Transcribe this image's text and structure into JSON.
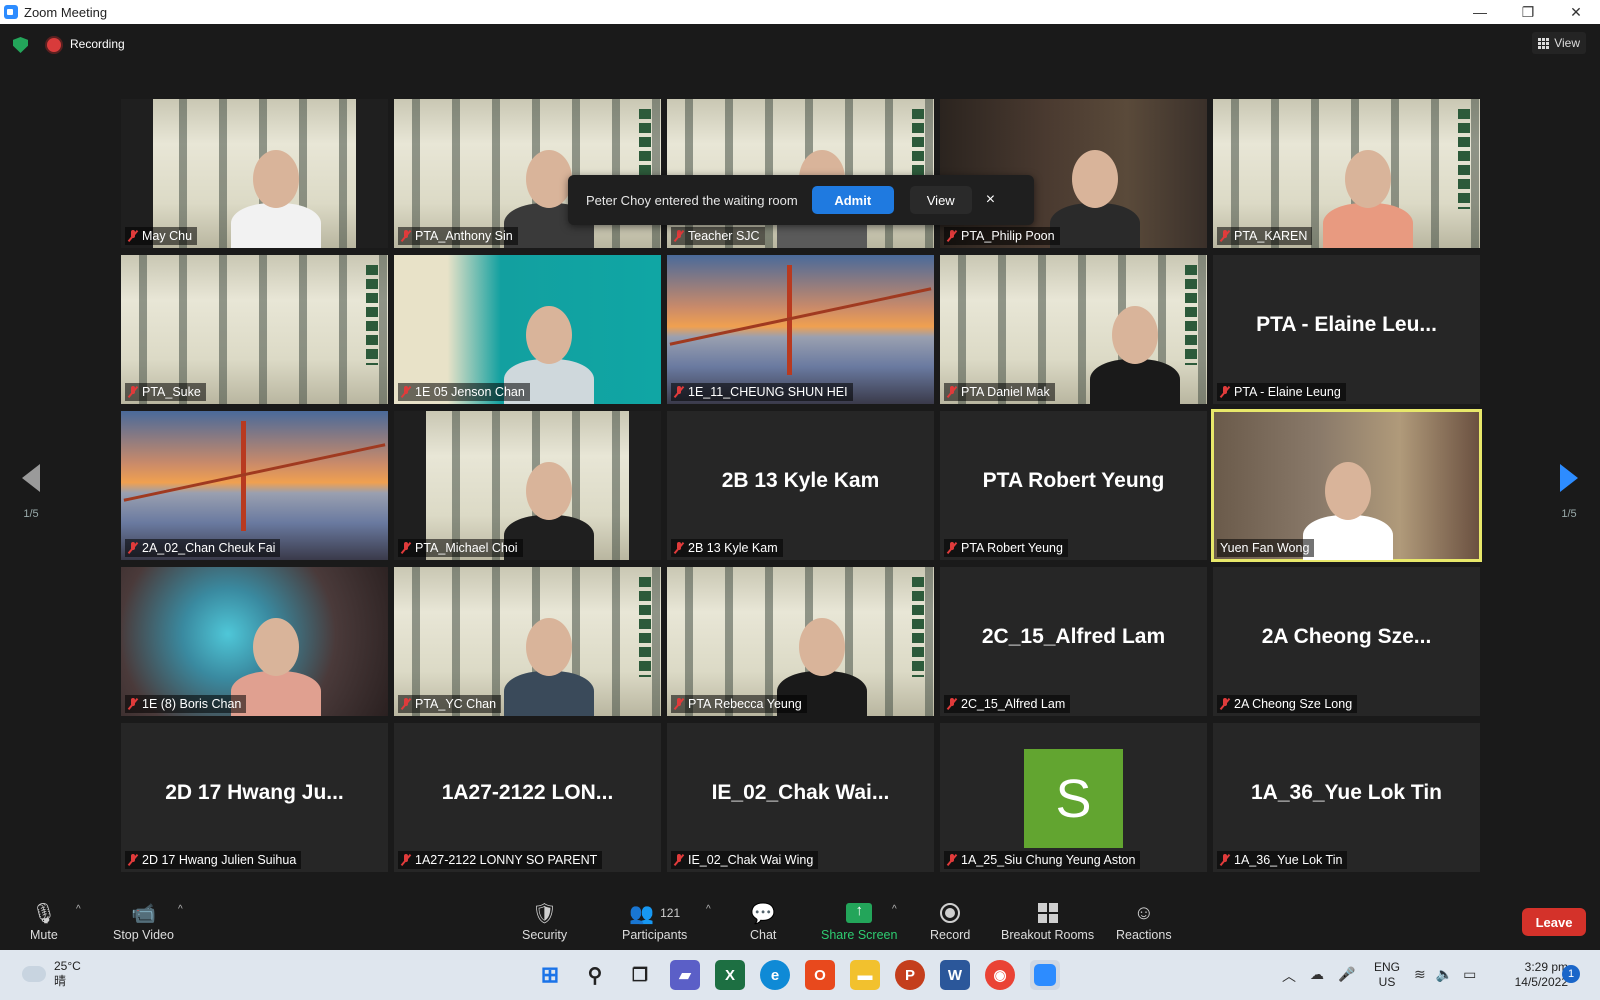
{
  "window": {
    "title": "Zoom Meeting",
    "minimize": "—",
    "restore": "❐",
    "close": "✕"
  },
  "topbar": {
    "recording": "Recording",
    "view": "View"
  },
  "pager": {
    "left": "1/5",
    "right": "1/5"
  },
  "tiles": [
    {
      "label": "May Chu",
      "big": "",
      "bg": "building"
    },
    {
      "label": "PTA_Anthony Sin",
      "big": "",
      "bg": "building"
    },
    {
      "label": "Teacher SJC",
      "big": "",
      "bg": "building"
    },
    {
      "label": "PTA_Philip Poon",
      "big": "",
      "bg": "office"
    },
    {
      "label": "PTA_KAREN",
      "big": "",
      "bg": "building"
    },
    {
      "label": "PTA_Suke",
      "big": "",
      "bg": "building"
    },
    {
      "label": "1E 05 Jenson Chan",
      "big": "",
      "bg": "teal"
    },
    {
      "label": "1E_11_CHEUNG SHUN HEI",
      "big": "",
      "bg": "bridge"
    },
    {
      "label": "PTA Daniel Mak",
      "big": "",
      "bg": "building"
    },
    {
      "label": "PTA - Elaine Leung",
      "big": "PTA - Elaine Leu...",
      "bg": "none"
    },
    {
      "label": "2A_02_Chan Cheuk Fai",
      "big": "",
      "bg": "bridge"
    },
    {
      "label": "PTA_Michael Choi",
      "big": "",
      "bg": "building"
    },
    {
      "label": "2B 13 Kyle Kam",
      "big": "2B 13 Kyle Kam",
      "bg": "none"
    },
    {
      "label": "PTA Robert Yeung",
      "big": "PTA Robert Yeung",
      "bg": "none"
    },
    {
      "label": "Yuen Fan Wong",
      "big": "",
      "bg": "room"
    },
    {
      "label": "1E (8) Boris Chan",
      "big": "",
      "bg": "blur"
    },
    {
      "label": "PTA_YC Chan",
      "big": "",
      "bg": "building"
    },
    {
      "label": "PTA Rebecca Yeung",
      "big": "",
      "bg": "building"
    },
    {
      "label": "2C_15_Alfred Lam",
      "big": "2C_15_Alfred Lam",
      "bg": "none"
    },
    {
      "label": "2A Cheong Sze Long",
      "big": "2A Cheong Sze...",
      "bg": "none"
    },
    {
      "label": "2D 17 Hwang Julien Suihua",
      "big": "2D 17 Hwang Ju...",
      "bg": "none"
    },
    {
      "label": "1A27-2122 LONNY SO PARENT",
      "big": "1A27-2122 LON...",
      "bg": "none"
    },
    {
      "label": "IE_02_Chak Wai Wing",
      "big": "IE_02_Chak Wai...",
      "bg": "none"
    },
    {
      "label": "1A_25_Siu Chung Yeung Aston",
      "big": "",
      "bg": "none",
      "avatar": "S"
    },
    {
      "label": "1A_36_Yue Lok Tin",
      "big": "1A_36_Yue Lok Tin",
      "bg": "none"
    }
  ],
  "waiting_notice": {
    "message": "Peter Choy entered the waiting room",
    "admit": "Admit",
    "view": "View",
    "close": "×"
  },
  "toolbar": {
    "mute": "Mute",
    "stop_video": "Stop Video",
    "security": "Security",
    "participants": "Participants",
    "participants_count": "121",
    "chat": "Chat",
    "share_screen": "Share Screen",
    "record": "Record",
    "breakout_rooms": "Breakout Rooms",
    "reactions": "Reactions",
    "leave": "Leave"
  },
  "taskbar": {
    "temperature": "25°C",
    "weather": "晴",
    "lang_top": "ENG",
    "lang_bottom": "US",
    "time": "3:29 pm",
    "date": "14/5/2022",
    "notifications": "1"
  },
  "colors": {
    "accent": "#2d8cff",
    "leave": "#d4322a",
    "share": "#23a55a",
    "active_border": "#e8e86a",
    "avatar": "#62a530"
  }
}
